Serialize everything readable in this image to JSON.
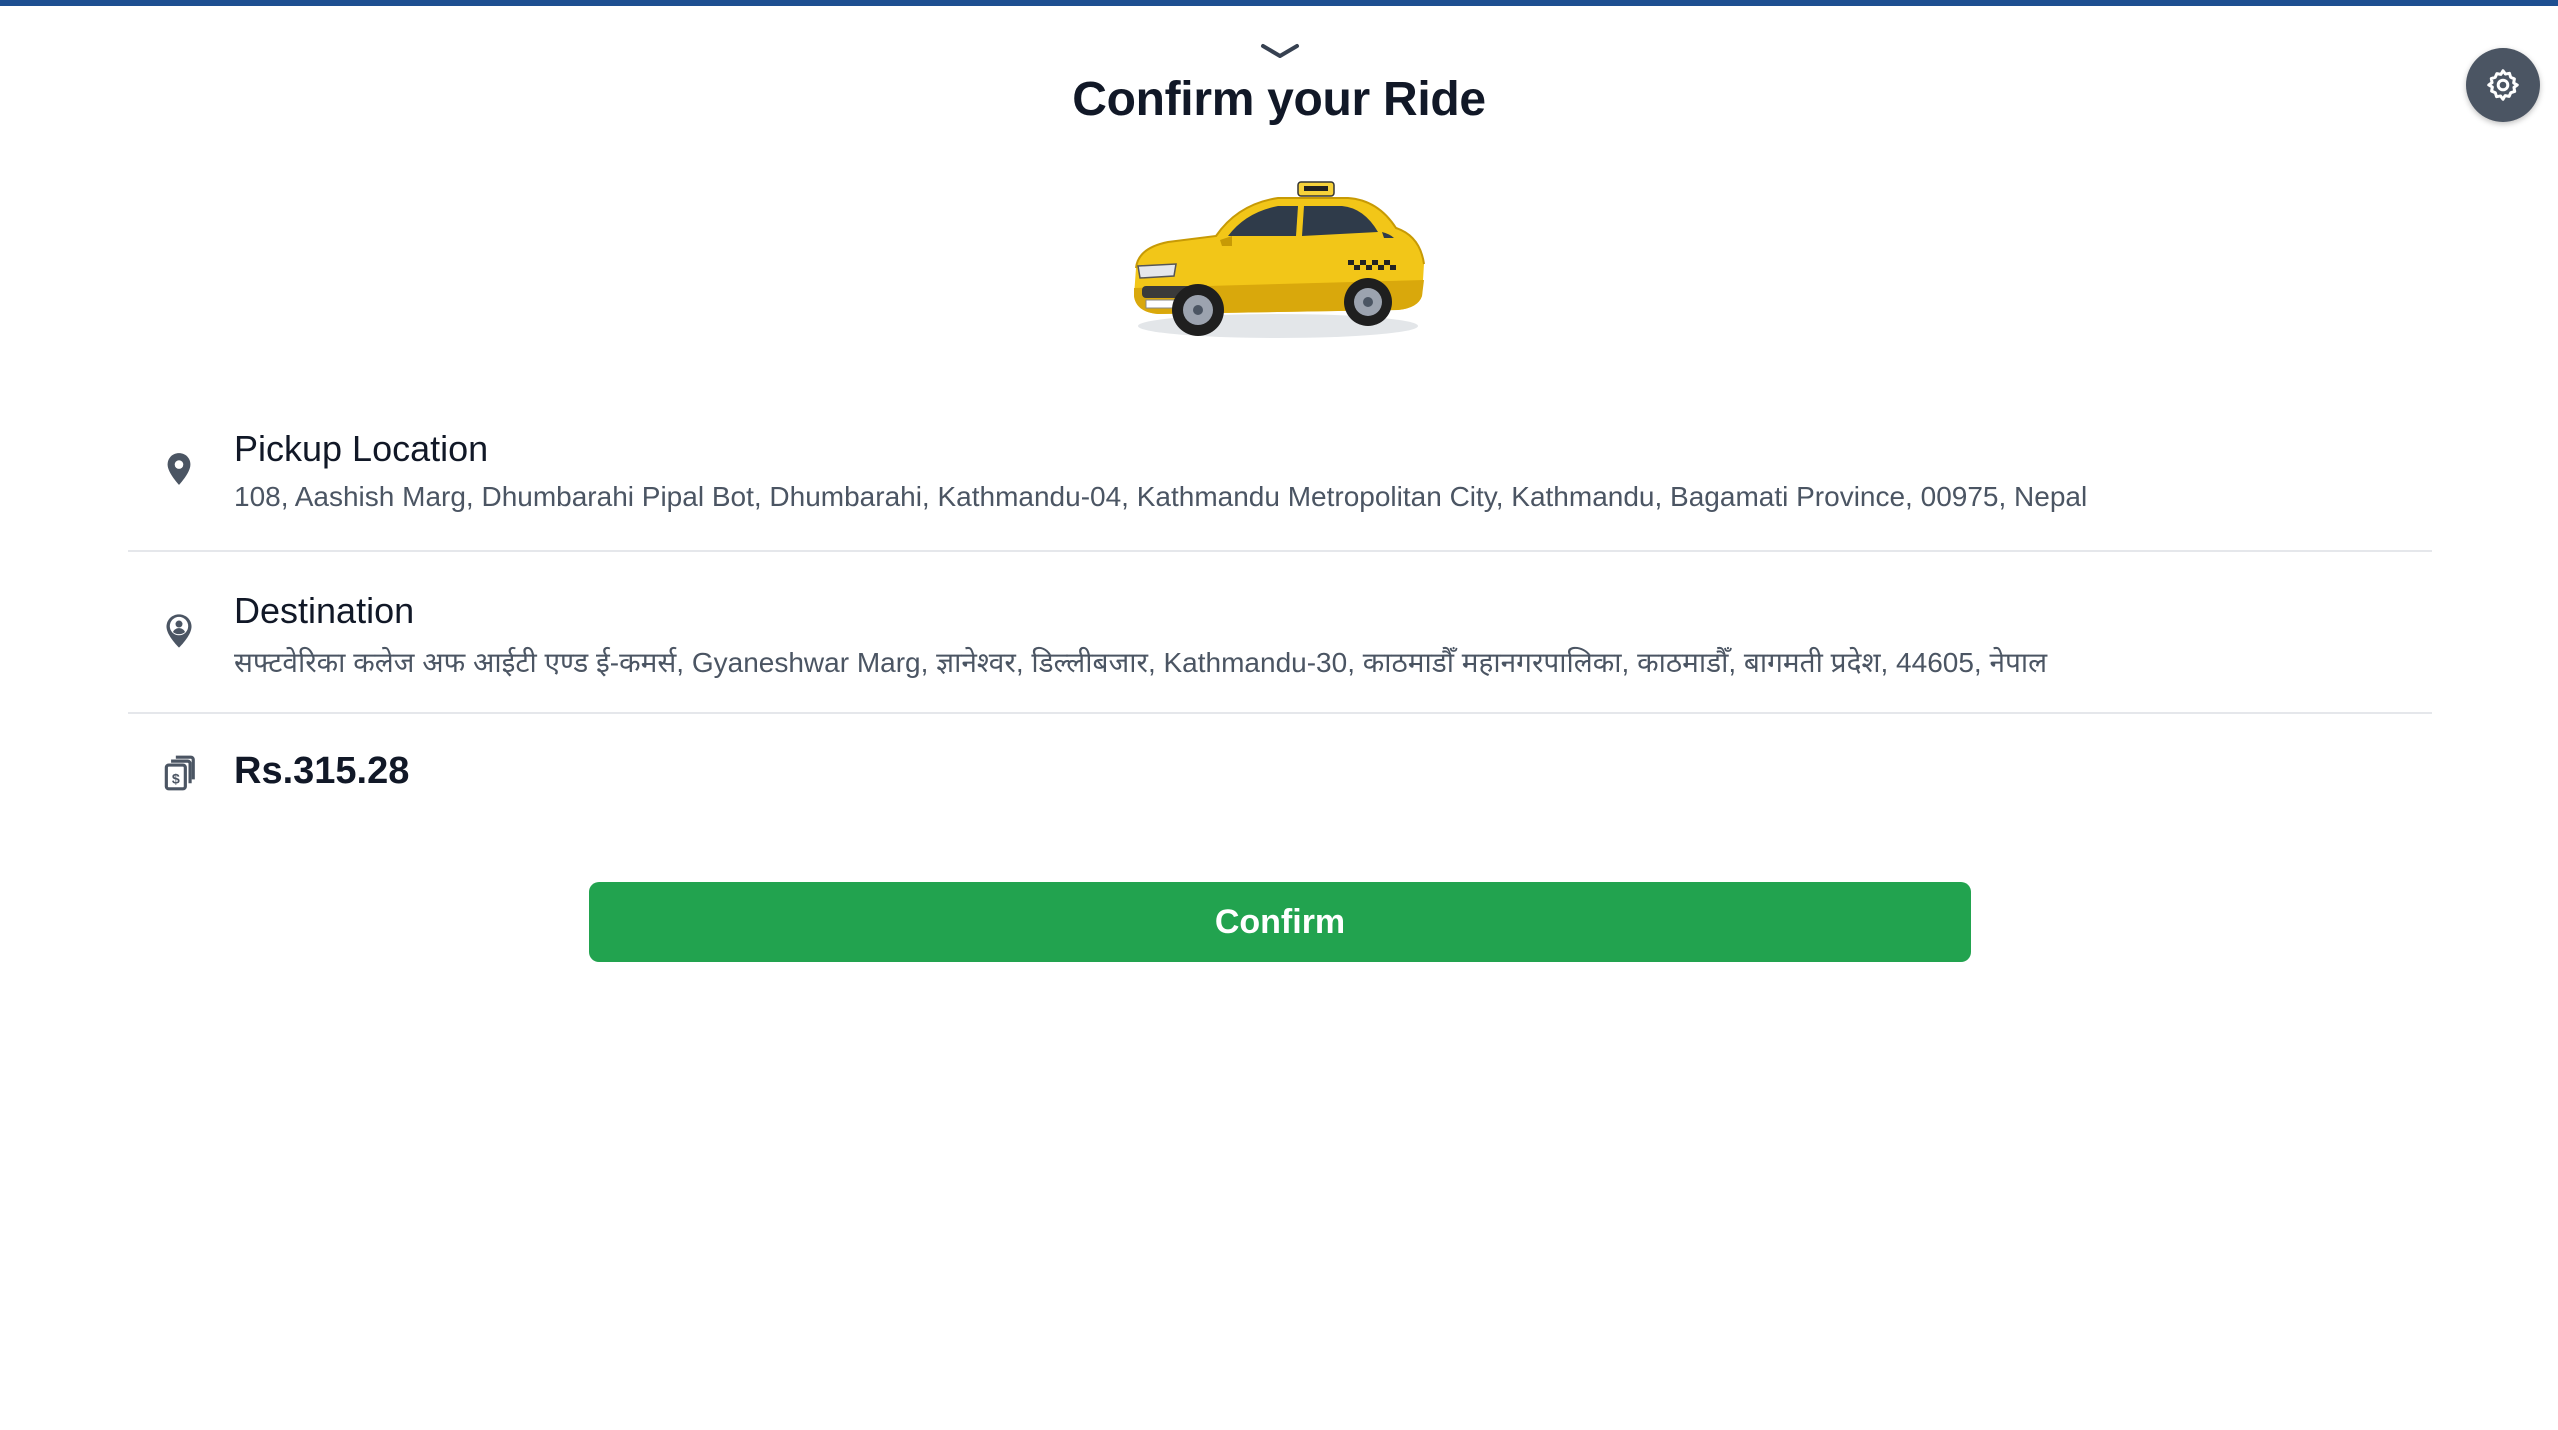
{
  "header": {
    "title": "Confirm your Ride",
    "collapse_icon": "chevron-down-icon",
    "settings_icon": "gear-icon",
    "accent_color": "#1e4f91"
  },
  "vehicle": {
    "image": "yellow-taxi-car"
  },
  "pickup": {
    "label": "Pickup Location",
    "address": "108, Aashish Marg, Dhumbarahi Pipal Bot, Dhumbarahi, Kathmandu-04, Kathmandu Metropolitan City, Kathmandu, Bagamati Province, 00975, Nepal",
    "icon": "map-pin-icon"
  },
  "destination": {
    "label": "Destination",
    "address": "सफ्टवेरिका कलेज अफ आईटी एण्ड ई-कमर्स, Gyaneshwar Marg, ज्ञानेश्वर, डिल्लीबजार, Kathmandu-30, काठमाडौँ महानगरपालिका, काठमाडौँ, बागमती प्रदेश, 44605, नेपाल",
    "icon": "person-pin-icon"
  },
  "fare": {
    "amount": "Rs.315.28",
    "icon": "money-bills-icon"
  },
  "actions": {
    "confirm_label": "Confirm",
    "confirm_color": "#22a34f"
  }
}
